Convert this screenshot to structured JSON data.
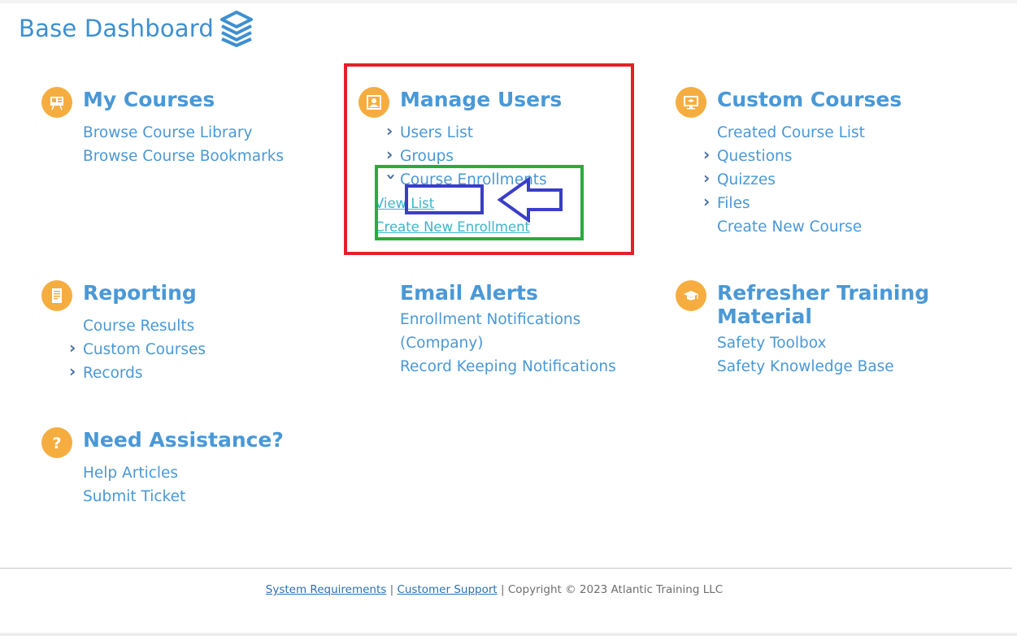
{
  "brand": {
    "title": "Base Dashboard",
    "icon": "stacked-layers-icon",
    "color": "#3d8fd1"
  },
  "colors": {
    "accent": "#4a98d6",
    "icon_bg": "#f6ad40",
    "subnav_link": "#3bb6c9",
    "annotation_red": "#e3202a",
    "annotation_green": "#28ad3c",
    "annotation_blue": "#3a3ec8"
  },
  "sections": {
    "my_courses": {
      "title": "My Courses",
      "icon": "presentation-board-icon",
      "links": [
        "Browse Course Library",
        "Browse Course Bookmarks"
      ]
    },
    "manage_users": {
      "title": "Manage Users",
      "icon": "user-id-card-icon",
      "links": [
        "Users List",
        "Groups",
        "Course Enrollments"
      ],
      "course_enrollments_sub": [
        "View List",
        "Create New Enrollment"
      ]
    },
    "custom_courses": {
      "title": "Custom Courses",
      "icon": "monitor-graduation-cap-icon",
      "links": [
        "Created Course List",
        "Questions",
        "Quizzes",
        "Files",
        "Create New Course"
      ]
    },
    "reporting": {
      "title": "Reporting",
      "icon": "report-document-icon",
      "links": [
        "Course Results",
        "Custom Courses",
        "Records"
      ]
    },
    "email_alerts": {
      "title": "Email Alerts",
      "links": [
        "Enrollment Notifications",
        "(Company)",
        "Record Keeping Notifications"
      ]
    },
    "refresher": {
      "title_line1": "Refresher Training",
      "title_line2": "Material",
      "icon": "graduation-cap-icon",
      "links": [
        "Safety Toolbox",
        "Safety Knowledge Base"
      ]
    },
    "assistance": {
      "title": "Need Assistance?",
      "icon": "question-mark-icon",
      "links": [
        "Help Articles",
        "Submit Ticket"
      ]
    }
  },
  "annotations": {
    "arrow": "left-arrow-icon"
  },
  "footer": {
    "system_requirements": "System Requirements",
    "separator": "|",
    "customer_support": "Customer Support",
    "copyright": "Copyright © 2023 Atlantic Training LLC"
  }
}
